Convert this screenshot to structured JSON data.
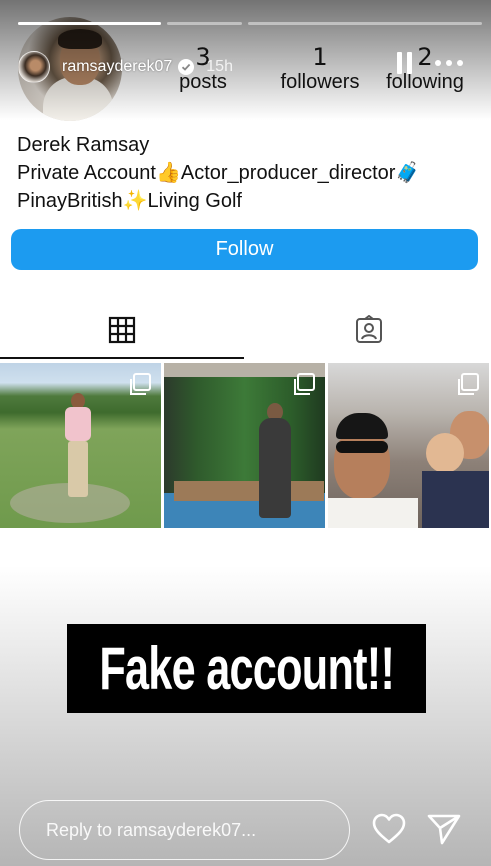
{
  "story": {
    "username": "ramsayderek07",
    "time": "15h",
    "progress": [
      1.0,
      0.0,
      0.0
    ]
  },
  "profile": {
    "stats": [
      {
        "num": "3",
        "label": "posts"
      },
      {
        "num": "1",
        "label": "followers"
      },
      {
        "num": "2",
        "label": "following"
      }
    ],
    "bio": [
      "Derek Ramsay",
      "Private Account👍Actor_producer_director🧳",
      "PinayBritish✨Living Golf"
    ],
    "follow_label": "Follow"
  },
  "tabs": [
    "grid-icon",
    "tagged-icon"
  ],
  "grid": [
    {
      "name": "golf-photo"
    },
    {
      "name": "plants-photo"
    },
    {
      "name": "selfie-photo"
    }
  ],
  "sticker": {
    "text": "Fake account!!"
  },
  "reply": {
    "placeholder": "Reply to ramsayderek07..."
  },
  "icons": {
    "heart": "heart-icon",
    "send": "send-icon",
    "pause": "pause-icon",
    "more": "more-icon",
    "verified": "verified-icon"
  },
  "colors": {
    "follow_button": "#1c9bf0",
    "sticker_bg": "#000000"
  }
}
